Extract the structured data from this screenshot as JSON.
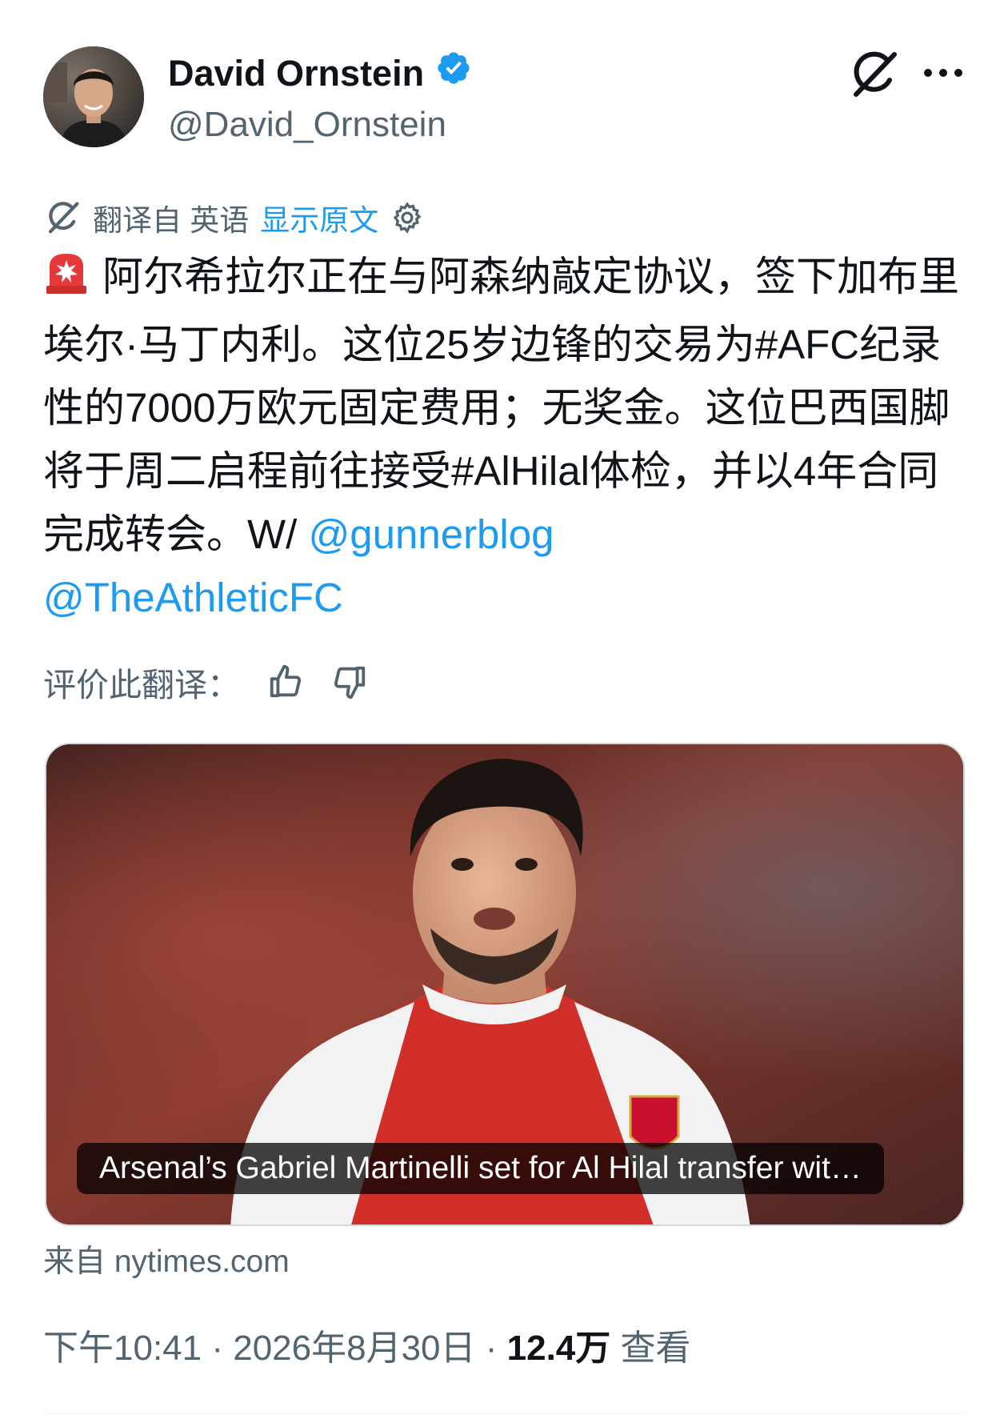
{
  "author": {
    "name": "David Ornstein",
    "handle": "@David_Ornstein",
    "verified": true,
    "avatar_icon": "avatar-photo"
  },
  "actions": {
    "grok_icon": "grok-icon",
    "more_icon": "more-options-icon"
  },
  "translation": {
    "translated_from": "翻译自 英语",
    "show_original": "显示原文",
    "settings_icon": "gear-icon"
  },
  "tweet": {
    "lead_icon": "siren-emoji",
    "text_1": "阿尔希拉尔正在与阿森纳敲定协议，签下加布里埃尔·马丁内利。这位25岁边锋的交易为#AFC纪录性的7000万欧元固定费用；无奖金。这位巴西国脚将于周二启程前往接受#AlHilal体检，并以4年合同完成转会。W/ ",
    "mention_1": "@gunnerblog",
    "mention_2": "@TheAthleticFC"
  },
  "rate_translation": {
    "label": "评价此翻译：",
    "thumbs_up_icon": "thumbs-up-icon",
    "thumbs_down_icon": "thumbs-down-icon"
  },
  "link_card": {
    "title": "Arsenal’s Gabriel Martinelli set for Al Hilal transfer wit…",
    "source": "来自 nytimes.com",
    "image": "football-player-photo"
  },
  "meta": {
    "time": "下午10:41",
    "separator": " · ",
    "date": "2026年8月30日",
    "views_count": "12.4万",
    "views_label": " 查看"
  },
  "colors": {
    "text_primary": "#0f1419",
    "text_secondary": "#536471",
    "link": "#1d9bf0",
    "verified": "#1d9bf0"
  }
}
